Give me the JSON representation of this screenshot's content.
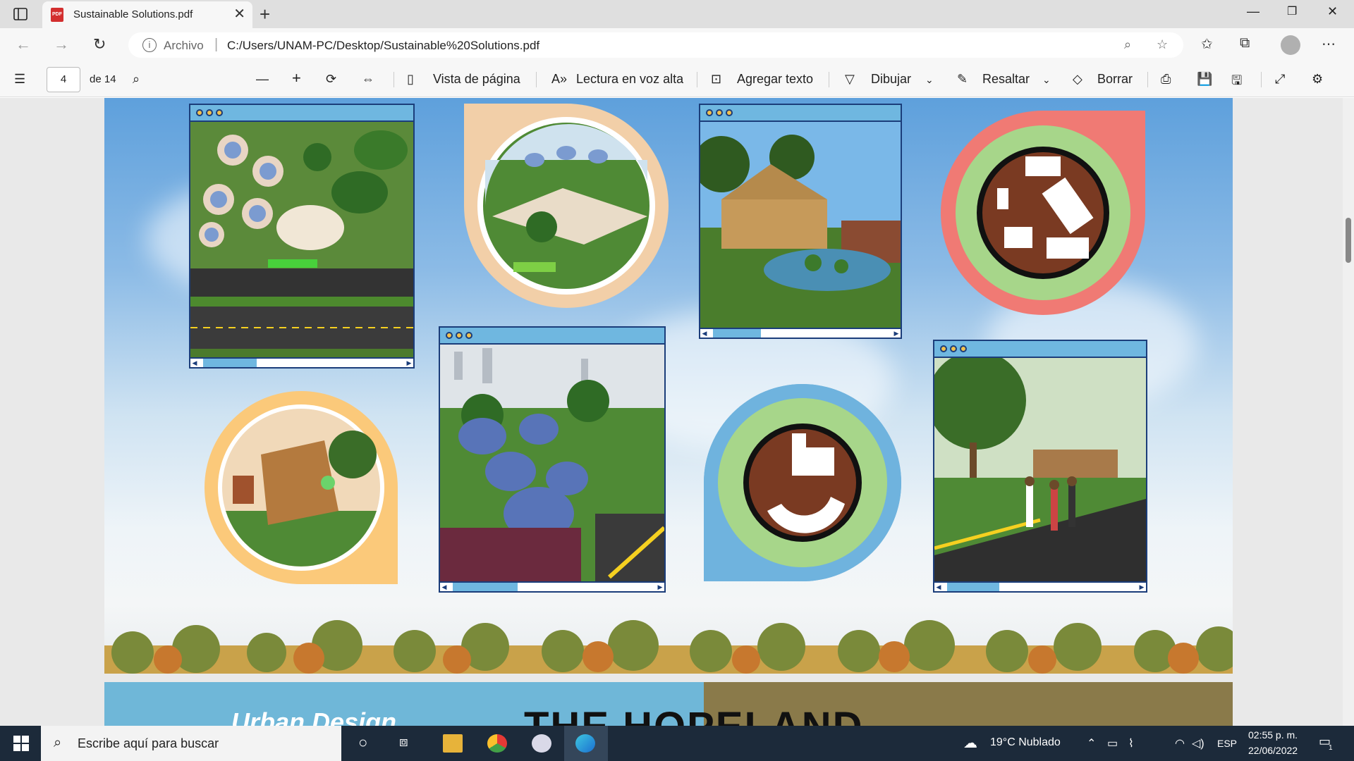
{
  "browser": {
    "tab_title": "Sustainable Solutions.pdf",
    "tab_icon": "PDF",
    "address_scheme": "Archivo",
    "address_url": "C:/Users/UNAM-PC/Desktop/Sustainable%20Solutions.pdf"
  },
  "pdf_toolbar": {
    "page_current": "4",
    "page_total": "de 14",
    "page_view": "Vista de página",
    "read_aloud": "Lectura en voz alta",
    "add_text": "Agregar texto",
    "draw": "Dibujar",
    "highlight": "Resaltar",
    "erase": "Borrar"
  },
  "next_page": {
    "subtitle": "Urban Design",
    "title": "THE HOPELAND"
  },
  "taskbar": {
    "search_placeholder": "Escribe aquí para buscar",
    "weather": "19°C  Nublado",
    "language": "ESP",
    "time": "02:55 p. m.",
    "date": "22/06/2022",
    "notifications": "1"
  },
  "colors": {
    "frame_border": "#1b3d7a",
    "frame_bar": "#6fb7e0",
    "bubble_peach": "#f2cfa8",
    "bubble_red": "#f07a74",
    "bubble_orange": "#fbc97a",
    "bubble_blue": "#6fb3de"
  }
}
